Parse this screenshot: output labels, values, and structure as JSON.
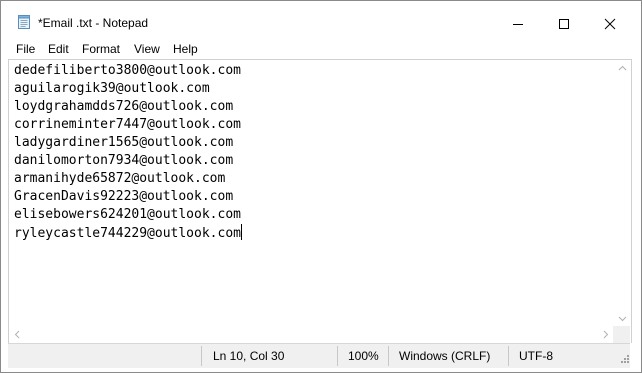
{
  "window": {
    "title": "*Email .txt - Notepad",
    "icon": "notepad-icon",
    "controls": {
      "minimize_icon": "minimize-icon",
      "maximize_icon": "maximize-icon",
      "close_icon": "close-icon"
    }
  },
  "menu": {
    "file": "File",
    "edit": "Edit",
    "format": "Format",
    "view": "View",
    "help": "Help"
  },
  "editor": {
    "lines": [
      "dedefiliberto3800@outlook.com",
      "aguilarogik39@outlook.com",
      "loydgrahamdds726@outlook.com",
      "corrineminter7447@outlook.com",
      "ladygardiner1565@outlook.com",
      "danilomorton7934@outlook.com",
      "armanihyde65872@outlook.com",
      "GracenDavis92223@outlook.com",
      "elisebowers624201@outlook.com",
      "ryleycastle744229@outlook.com"
    ]
  },
  "status": {
    "position": "Ln 10, Col 30",
    "zoom": "100%",
    "line_ending": "Windows (CRLF)",
    "encoding": "UTF-8"
  }
}
